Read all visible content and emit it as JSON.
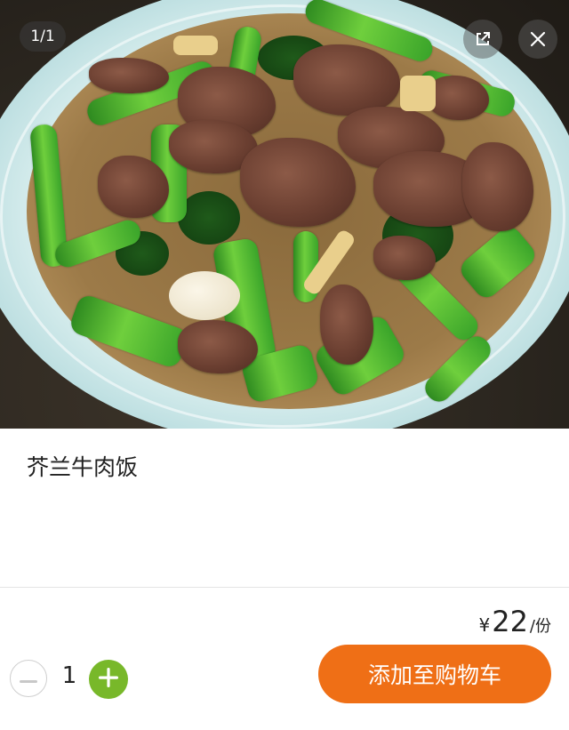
{
  "gallery": {
    "counter": "1/1"
  },
  "dish": {
    "name": "芥兰牛肉饭",
    "price": {
      "currency": "¥",
      "amount": "22",
      "unit": "/份"
    }
  },
  "cart": {
    "quantity": "1",
    "add_label": "添加至购物车"
  },
  "icons": {
    "share": "external-link-icon",
    "close": "close-icon",
    "minus": "minus-icon",
    "plus": "plus-icon"
  },
  "colors": {
    "accent_orange": "#ef6f16",
    "plus_green": "#78b82a"
  }
}
